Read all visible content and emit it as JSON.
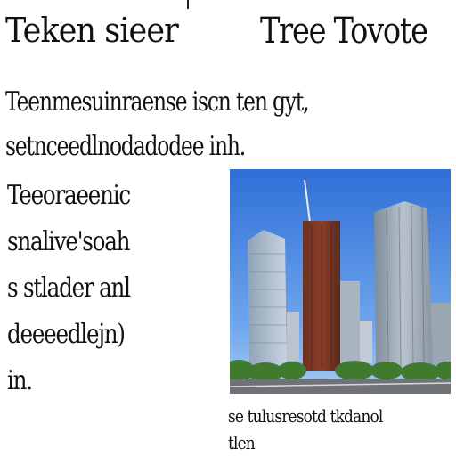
{
  "header": {
    "title_left": "Teken sieer",
    "title_right": "Tree Tovote"
  },
  "intro": {
    "lines": [
      "Teenmesuinraense iscn ten gyt,",
      "setnceedlnodadodee inh."
    ]
  },
  "side_text": {
    "lines": [
      "Teeoraeenic",
      "snalive'soah",
      "s stlader anl",
      "deeeedlejn)",
      "in."
    ]
  },
  "figure": {
    "subject": "city skyline with skyscrapers"
  },
  "caption": {
    "lines": [
      "se tulusresotd tkdanol",
      "tlen"
    ]
  }
}
